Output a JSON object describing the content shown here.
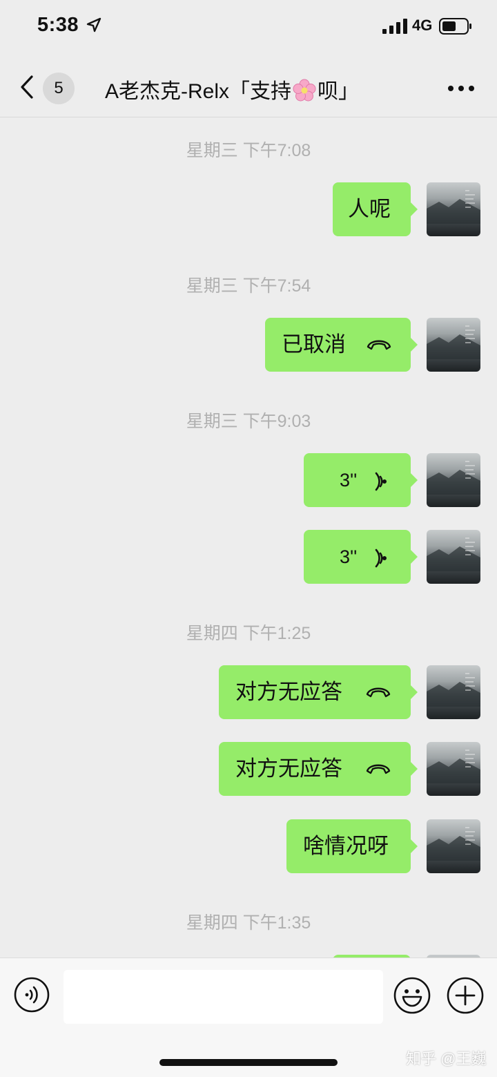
{
  "status_bar": {
    "time": "5:38",
    "network": "4G"
  },
  "nav": {
    "unread_count": "5",
    "title_before": "A老杰克-Relx「支持",
    "title_after": "呗」"
  },
  "messages": [
    {
      "timestamp": "星期三 下午7:08"
    },
    {
      "text": "人呢"
    },
    {
      "timestamp": "星期三 下午7:54"
    },
    {
      "text": "已取消",
      "icon": "phone-icon"
    },
    {
      "timestamp": "星期三 下午9:03"
    },
    {
      "text": "3''",
      "icon": "voice-wave-icon"
    },
    {
      "text": "3''",
      "icon": "voice-wave-icon"
    },
    {
      "timestamp": "星期四 下午1:25"
    },
    {
      "text": "对方无应答",
      "icon": "phone-icon"
    },
    {
      "text": "对方无应答",
      "icon": "phone-icon"
    },
    {
      "text": "啥情况呀"
    },
    {
      "timestamp": "星期四 下午1:35"
    }
  ],
  "input_bar": {
    "value": ""
  },
  "watermark": "知乎 @王巍",
  "colors": {
    "bubble": "#95ec69",
    "background": "#ededed",
    "timestamp": "#b0b0b0"
  }
}
